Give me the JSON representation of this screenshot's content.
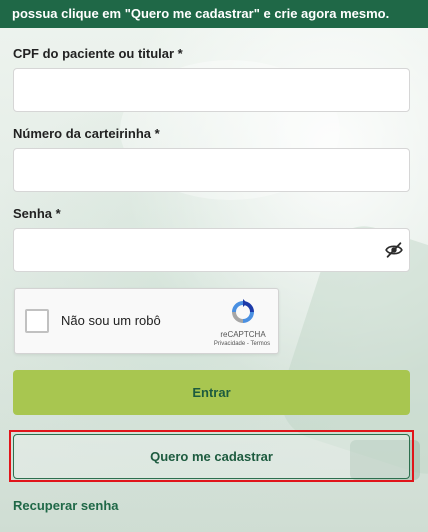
{
  "banner": {
    "text": "possua clique em \"Quero me cadastrar\" e crie agora mesmo."
  },
  "form": {
    "cpf": {
      "label": "CPF do paciente ou titular *",
      "value": "",
      "placeholder": ""
    },
    "carteirinha": {
      "label": "Número da carteirinha *",
      "value": "",
      "placeholder": ""
    },
    "senha": {
      "label": "Senha *",
      "value": "",
      "placeholder": "",
      "toggle_icon": "eye-slash-icon"
    }
  },
  "recaptcha": {
    "label": "Não sou um robô",
    "brand": "reCAPTCHA",
    "links": "Privacidade - Termos",
    "checked": false
  },
  "buttons": {
    "entrar": "Entrar",
    "cadastrar": "Quero me cadastrar"
  },
  "links": {
    "recuperar": "Recuperar senha"
  },
  "colors": {
    "banner_bg": "#1f6847",
    "primary_button": "#a8c650",
    "primary_text": "#1d5b3f",
    "highlight": "#e0151a"
  }
}
